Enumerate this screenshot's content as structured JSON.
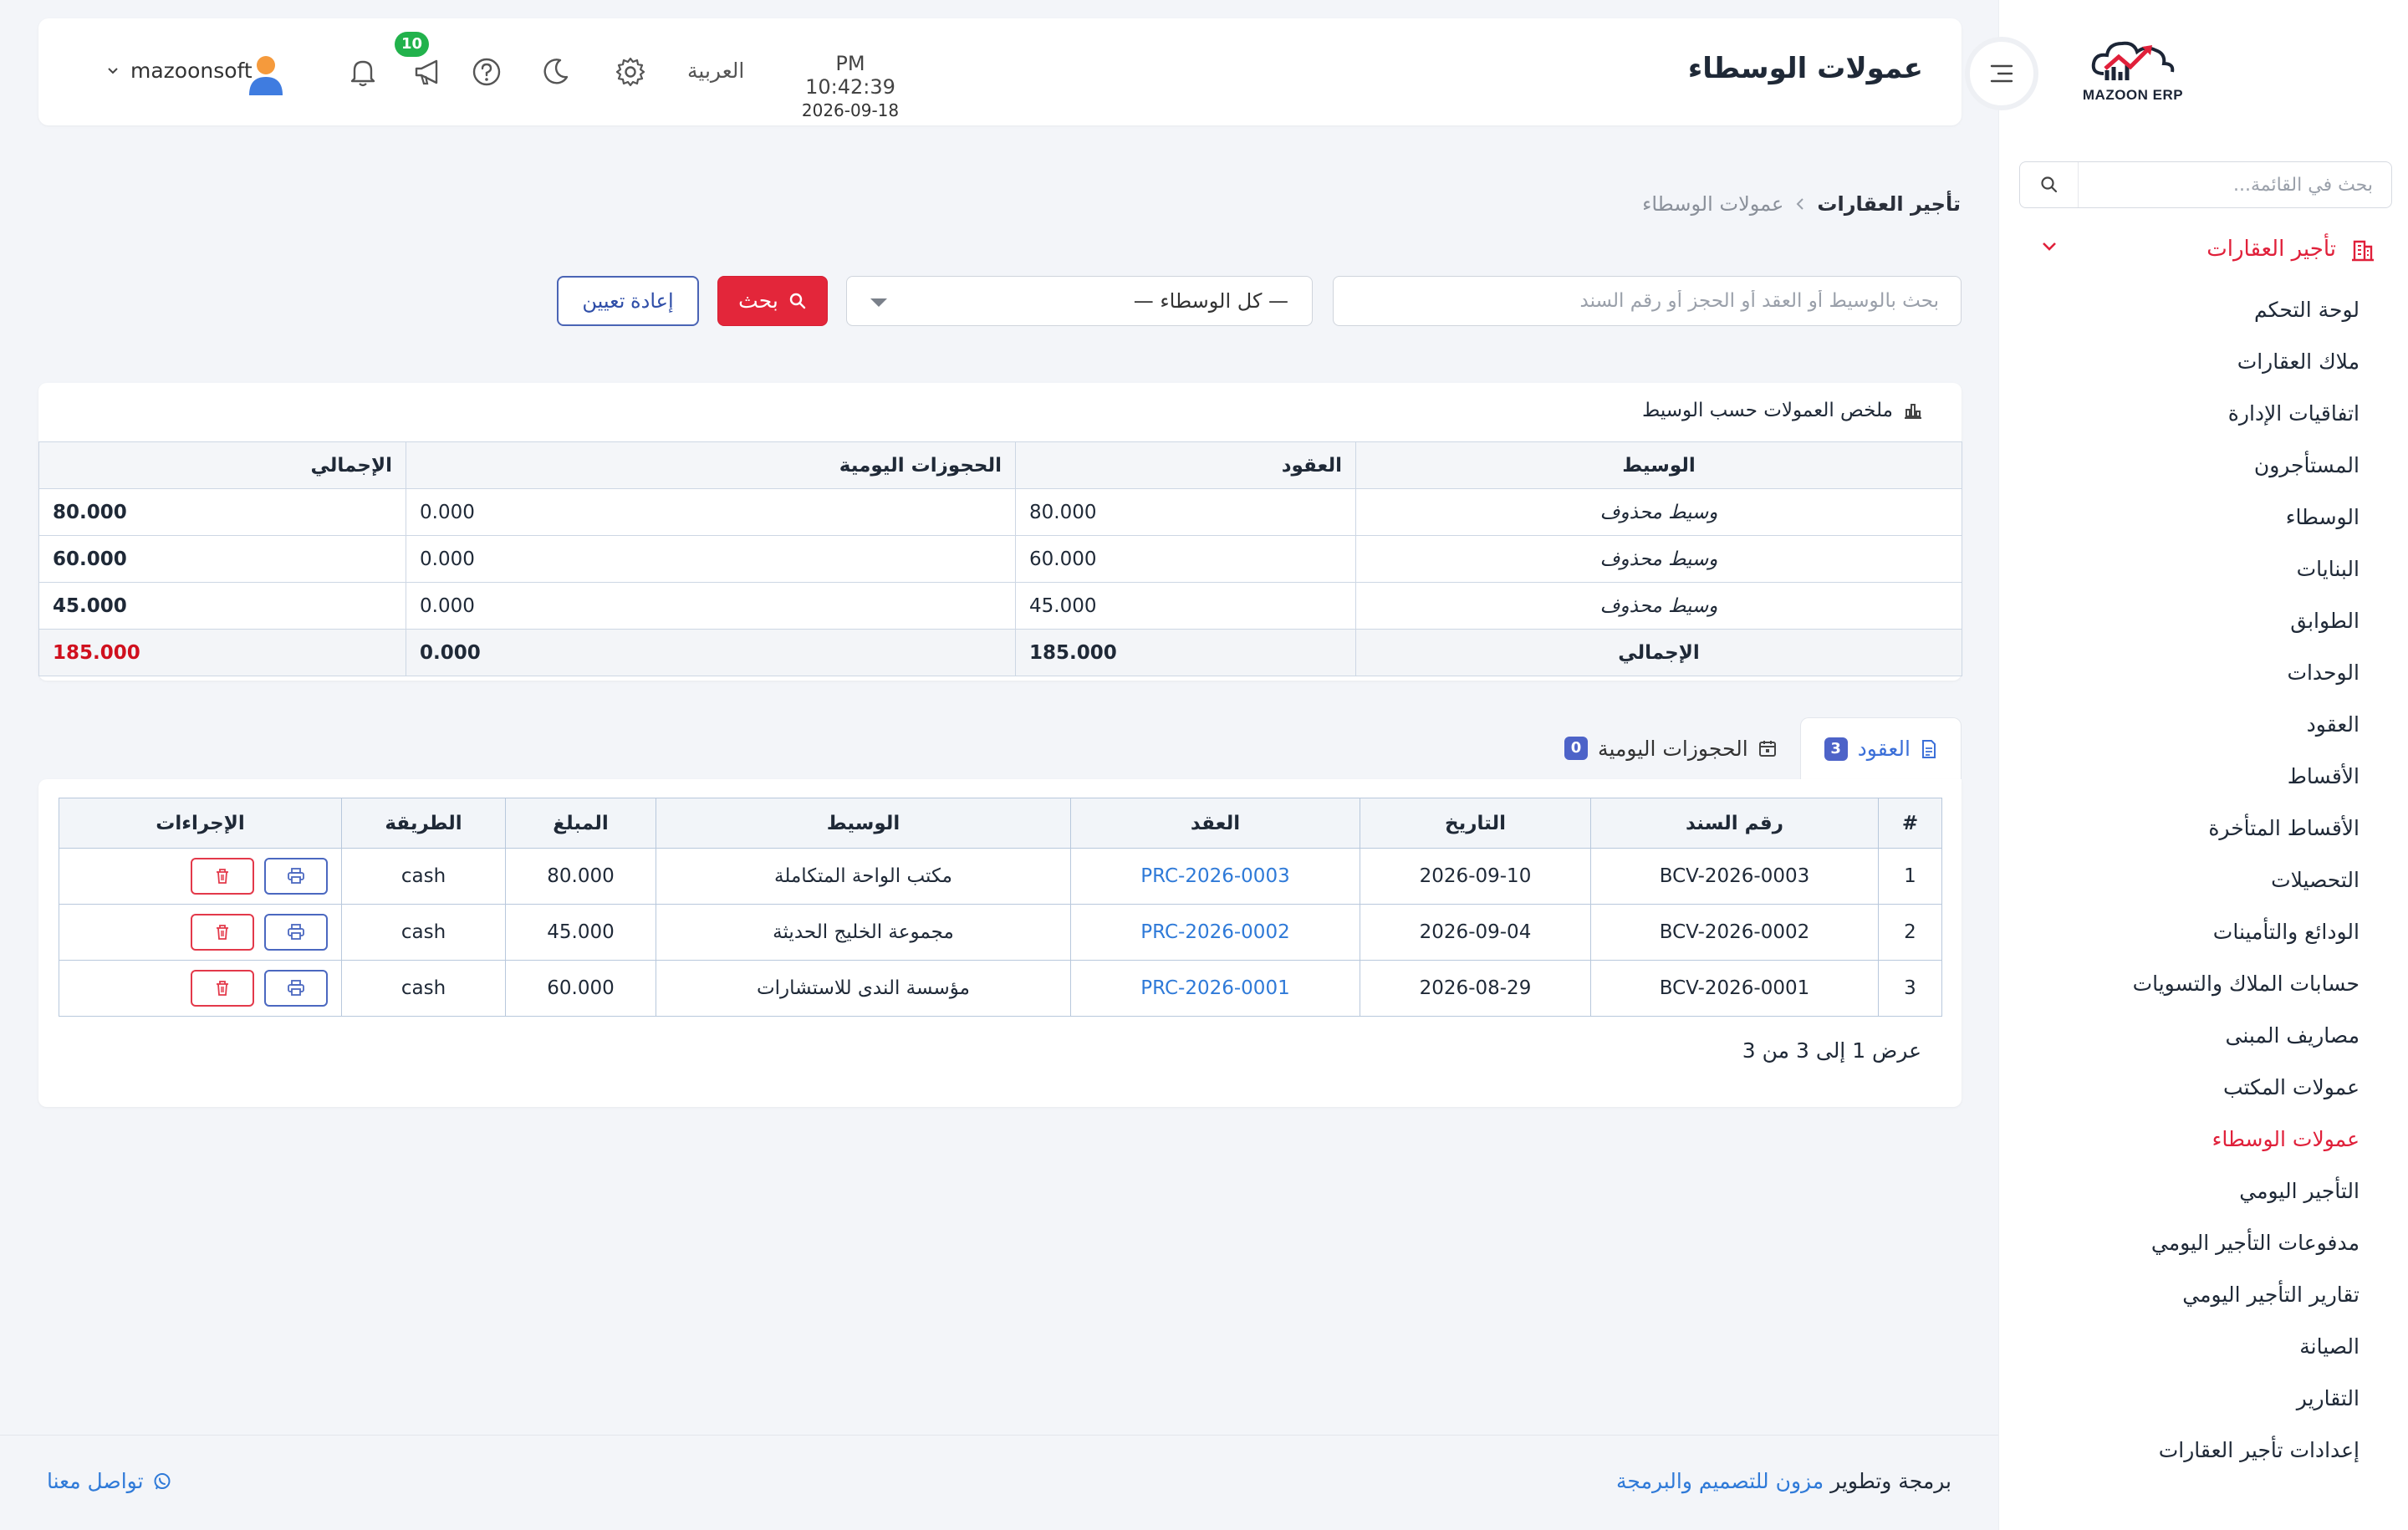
{
  "colors": {
    "accent": "#e0203a",
    "primary": "#4d63c8",
    "link": "#2f7ad8",
    "success_badge": "#22b24c"
  },
  "sidebar": {
    "logo_text": "MAZOON ERP",
    "search_placeholder": "بحث في القائمة...",
    "group": {
      "label": "تأجير العقارات",
      "icon": "building-icon",
      "expanded": true
    },
    "items": [
      {
        "label": "لوحة التحكم",
        "active": false
      },
      {
        "label": "ملاك العقارات",
        "active": false
      },
      {
        "label": "اتفاقيات الإدارة",
        "active": false
      },
      {
        "label": "المستأجرون",
        "active": false
      },
      {
        "label": "الوسطاء",
        "active": false
      },
      {
        "label": "البنايات",
        "active": false
      },
      {
        "label": "الطوابق",
        "active": false
      },
      {
        "label": "الوحدات",
        "active": false
      },
      {
        "label": "العقود",
        "active": false
      },
      {
        "label": "الأقساط",
        "active": false
      },
      {
        "label": "الأقساط المتأخرة",
        "active": false
      },
      {
        "label": "التحصيلات",
        "active": false
      },
      {
        "label": "الودائع والتأمينات",
        "active": false
      },
      {
        "label": "حسابات الملاك والتسويات",
        "active": false
      },
      {
        "label": "مصاريف المبنى",
        "active": false
      },
      {
        "label": "عمولات المكتب",
        "active": false
      },
      {
        "label": "عمولات الوسطاء",
        "active": true
      },
      {
        "label": "التأجير اليومي",
        "active": false
      },
      {
        "label": "مدفوعات التأجير اليومي",
        "active": false
      },
      {
        "label": "تقارير التأجير اليومي",
        "active": false
      },
      {
        "label": "الصيانة",
        "active": false
      },
      {
        "label": "التقارير",
        "active": false
      },
      {
        "label": "إعدادات تأجير العقارات",
        "active": false
      }
    ]
  },
  "header": {
    "title": "عمولات الوسطاء",
    "time": "PM 10:42:39",
    "date": "2026-09-18",
    "language": "العربية",
    "notification_count": "10",
    "username": "mazoonsoft",
    "icons": [
      "menu-toggle-icon",
      "settings-icon",
      "dark-mode-icon",
      "help-icon",
      "announcement-icon",
      "bell-icon",
      "user-avatar"
    ]
  },
  "breadcrumb": {
    "parent": "تأجير العقارات",
    "current": "عمولات الوسطاء"
  },
  "filters": {
    "search_placeholder": "بحث بالوسيط أو العقد أو الحجز أو رقم السند",
    "broker_select_value": "— كل الوسطاء —",
    "search_button": "بحث",
    "reset_button": "إعادة تعيين"
  },
  "summary": {
    "title": "ملخص العمولات حسب الوسيط",
    "columns": [
      "الوسيط",
      "العقود",
      "الحجوزات اليومية",
      "الإجمالي"
    ],
    "rows": [
      {
        "broker": "وسيط محذوف",
        "contracts": "80.000",
        "daily": "0.000",
        "total": "80.000"
      },
      {
        "broker": "وسيط محذوف",
        "contracts": "60.000",
        "daily": "0.000",
        "total": "60.000"
      },
      {
        "broker": "وسيط محذوف",
        "contracts": "45.000",
        "daily": "0.000",
        "total": "45.000"
      }
    ],
    "totals": {
      "label": "الإجمالي",
      "contracts": "185.000",
      "daily": "0.000",
      "total": "185.000"
    }
  },
  "tabs": [
    {
      "label": "العقود",
      "count": "3",
      "active": true
    },
    {
      "label": "الحجوزات اليومية",
      "count": "0",
      "active": false
    }
  ],
  "records": {
    "columns": [
      "#",
      "رقم السند",
      "التاريخ",
      "العقد",
      "الوسيط",
      "المبلغ",
      "الطريقة",
      "الإجراءات"
    ],
    "rows": [
      {
        "n": "1",
        "voucher": "BCV-2026-0003",
        "date": "2026-09-10",
        "contract": "PRC-2026-0003",
        "broker": "مكتب الواحة المتكاملة",
        "amount": "80.000",
        "method": "cash"
      },
      {
        "n": "2",
        "voucher": "BCV-2026-0002",
        "date": "2026-09-04",
        "contract": "PRC-2026-0002",
        "broker": "مجموعة الخليج الحديثة",
        "amount": "45.000",
        "method": "cash"
      },
      {
        "n": "3",
        "voucher": "BCV-2026-0001",
        "date": "2026-08-29",
        "contract": "PRC-2026-0001",
        "broker": "مؤسسة الندى للاستشارات",
        "amount": "60.000",
        "method": "cash"
      }
    ],
    "pagination": "عرض 1 إلى 3 من 3"
  },
  "footer": {
    "credit_prefix": "برمجة وتطوير",
    "company": "مزون للتصميم والبرمجة",
    "contact": "تواصل معنا"
  }
}
